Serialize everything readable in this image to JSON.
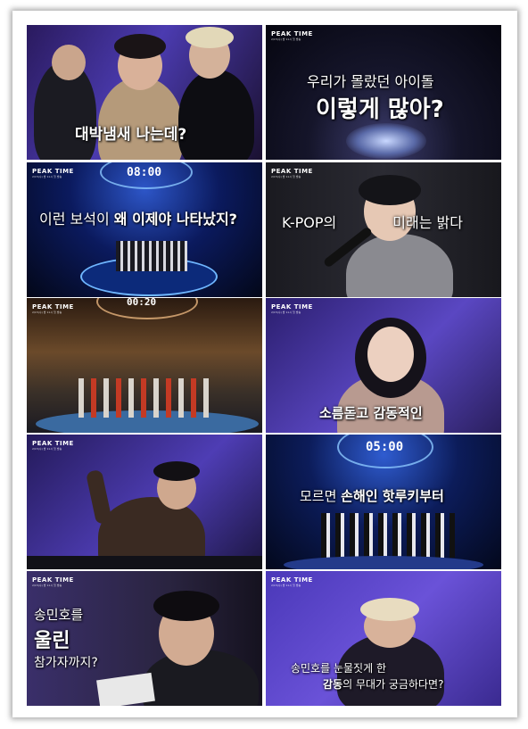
{
  "brand": {
    "logo": "PEAK TIME",
    "sub": "2/15(수) 밤 11시 첫 방송"
  },
  "panels": [
    {
      "caption": "대박냄새 나는데?"
    },
    {
      "caption_line1": "우리가 몰랐던 아이돌",
      "caption_line2": "이렇게 많아?"
    },
    {
      "timer": "08:00",
      "caption_pre": "이런 보석이 ",
      "caption_em": "왜 이제야 나타났지?"
    },
    {
      "caption_pre": "K-POP의 ",
      "caption_em": "미래는 밝다"
    },
    {
      "timer": "00:20"
    },
    {
      "caption_pre": "소름돋고 ",
      "caption_em": "감동적인"
    },
    {},
    {
      "timer": "05:00",
      "caption_pre": "모르면 ",
      "caption_em": "손해인 핫루키부터"
    },
    {
      "caption_line1": "송민호를",
      "caption_line2": "울린",
      "caption_line3": "참가자까지?"
    },
    {
      "caption_line1": "송민호를 눈물짓게 한",
      "caption_em": "감동",
      "caption_post": "의 무대가 궁금하다면?"
    }
  ]
}
